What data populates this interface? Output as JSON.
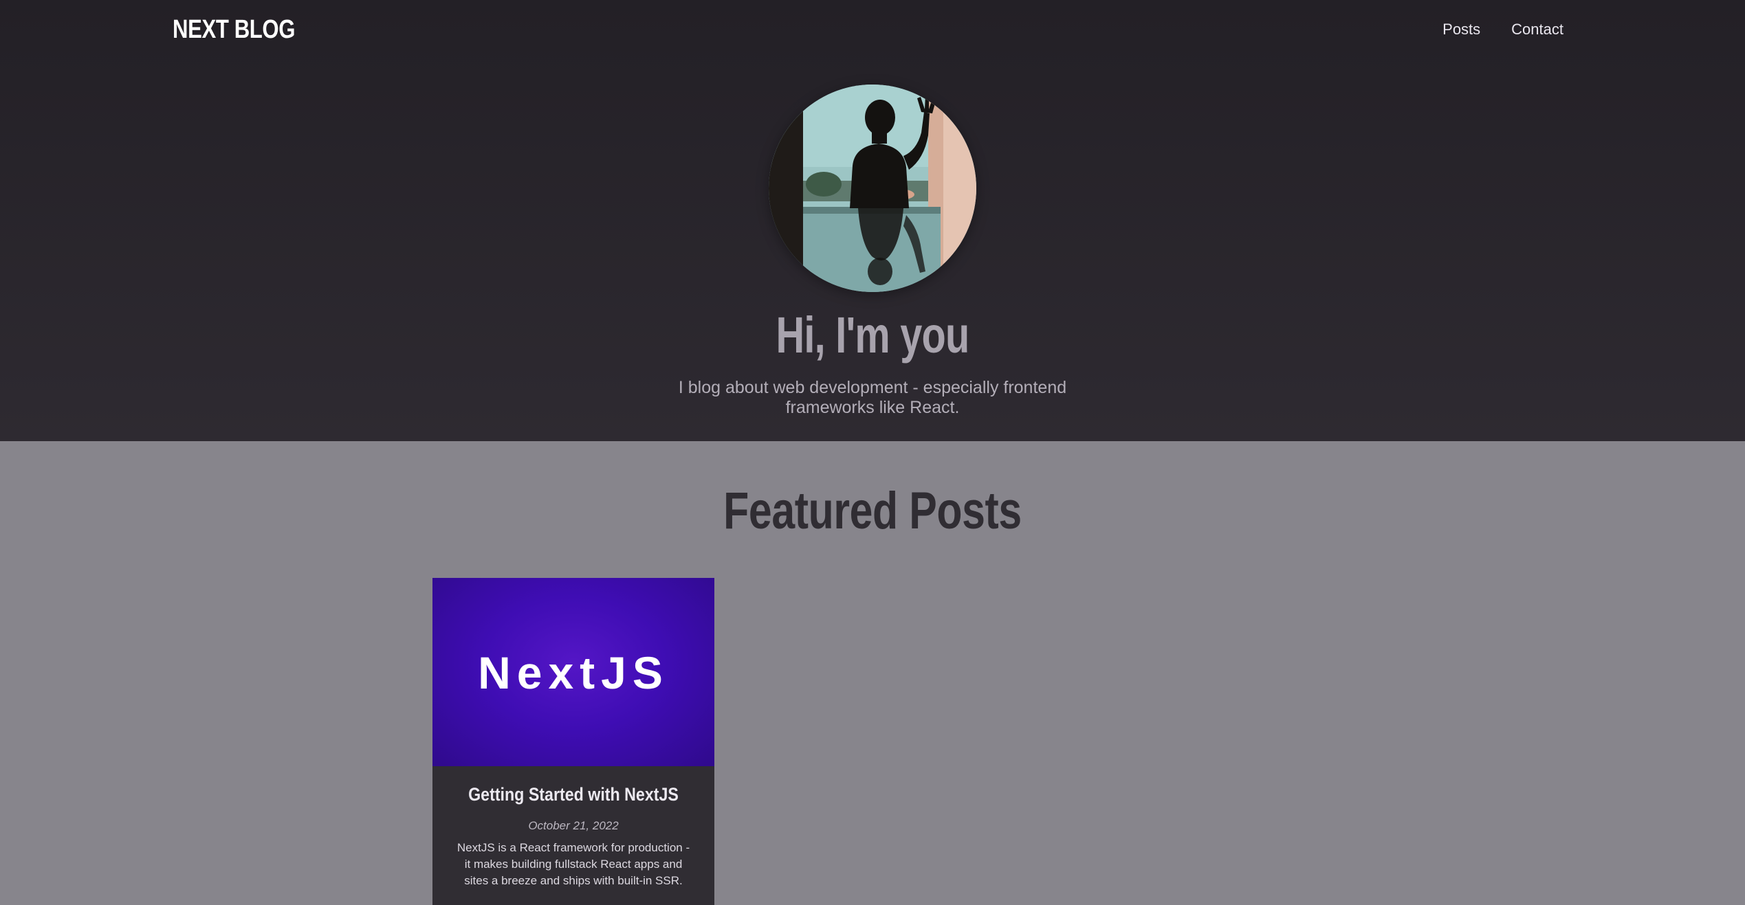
{
  "header": {
    "logo": "NEXT BLOG",
    "nav": [
      "Posts",
      "Contact"
    ]
  },
  "hero": {
    "title": "Hi, I'm you",
    "subtitle": "I blog about web development - especially frontend frameworks like React."
  },
  "featured": {
    "heading": "Featured Posts",
    "posts": [
      {
        "image_text": "NextJS",
        "title": "Getting Started with NextJS",
        "date": "October 21, 2022",
        "excerpt": "NextJS is a React framework for production - it makes building fullstack React apps and sites a breeze and ships with built-in SSR."
      }
    ]
  },
  "colors": {
    "header_bg": "#232026",
    "page_bg": "#87858c",
    "card_bg": "#302d33",
    "nextjs_purple": "#4410b8"
  }
}
